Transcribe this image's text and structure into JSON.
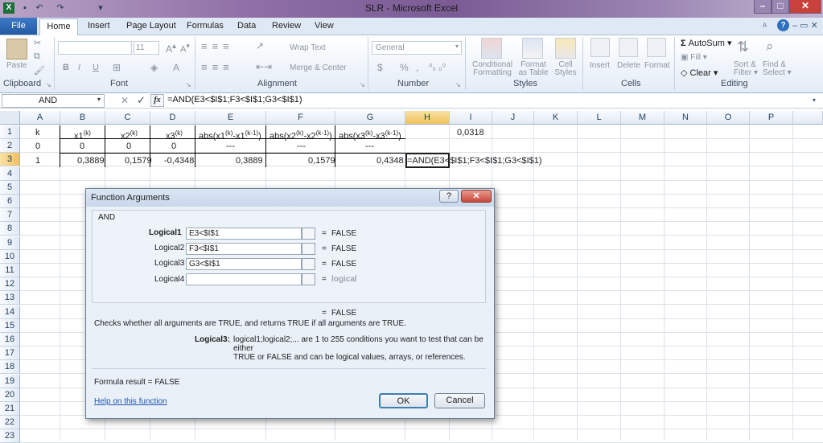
{
  "window": {
    "title": "SLR - Microsoft Excel"
  },
  "tabs": [
    "File",
    "Home",
    "Insert",
    "Page Layout",
    "Formulas",
    "Data",
    "Review",
    "View"
  ],
  "ribbon": {
    "paste": "Paste",
    "font_size": "11",
    "wrap_text": "Wrap Text",
    "merge_center": "Merge & Center",
    "number_format": "General",
    "percent": "%",
    "comma": ",",
    "conditional": [
      "Conditional",
      "Formatting"
    ],
    "format_table": [
      "Format",
      "as Table"
    ],
    "cell_styles": [
      "Cell",
      "Styles"
    ],
    "insert": "Insert",
    "delete": "Delete",
    "format": "Format",
    "autosum": "AutoSum",
    "fill": "Fill",
    "clear": "Clear",
    "sort": [
      "Sort &",
      "Filter"
    ],
    "find": [
      "Find &",
      "Select"
    ],
    "groups": [
      "Clipboard",
      "Font",
      "Alignment",
      "Number",
      "Styles",
      "Cells",
      "Editing"
    ]
  },
  "formula_bar": {
    "name_box": "AND",
    "fx": "fx",
    "formula": "=AND(E3<$I$1;F3<$I$1;G3<$I$1)"
  },
  "sheet": {
    "columns": [
      "A",
      "B",
      "C",
      "D",
      "E",
      "F",
      "G",
      "H",
      "I",
      "J",
      "K",
      "L",
      "M",
      "N",
      "O",
      "P"
    ],
    "rows": [
      "1",
      "2",
      "3",
      "4",
      "5",
      "6",
      "7",
      "8",
      "9",
      "10",
      "11",
      "12",
      "13",
      "14",
      "15",
      "16",
      "17",
      "18",
      "19",
      "20",
      "21",
      "22",
      "23"
    ],
    "row1": {
      "A": "k",
      "B": "x1",
      "C": "x2",
      "D": "x3",
      "E": "abs(x1",
      "E2": "-x1",
      "E3": ")",
      "F": "abs(x2",
      "F2": "-x2",
      "F3": ")",
      "G": "abs(x3",
      "G2": "-x3",
      "G3": ")",
      "I": "0,0318",
      "sup_k": "(k)",
      "sup_k1": "(k-1)"
    },
    "row2": {
      "A": "0",
      "B": "0",
      "C": "0",
      "D": "0",
      "E": "---",
      "F": "---",
      "G": "---"
    },
    "row3": {
      "A": "1",
      "B": "0,3889",
      "C": "0,1579",
      "D": "-0,4348",
      "E": "0,3889",
      "F": "0,1579",
      "G": "0,4348",
      "H": "=AND(E3<$I$1;F3<$I$1;G3<$I$1)"
    }
  },
  "dialog": {
    "title": "Function Arguments",
    "function": "AND",
    "args": [
      {
        "label": "Logical1",
        "value": "E3<$I$1",
        "result": "FALSE"
      },
      {
        "label": "Logical2",
        "value": "F3<$I$1",
        "result": "FALSE"
      },
      {
        "label": "Logical3",
        "value": "G3<$I$1",
        "result": "FALSE"
      },
      {
        "label": "Logical4",
        "value": "",
        "result": "logical"
      }
    ],
    "eq": "=",
    "total": "FALSE",
    "description": "Checks whether all arguments are TRUE, and returns TRUE if all arguments are TRUE.",
    "arg_help_label": "Logical3:",
    "arg_help_text1": "logical1;logical2;... are 1 to 255 conditions you want to test that can be either",
    "arg_help_text2": "TRUE or FALSE and can be logical values, arrays, or references.",
    "formula_result_label": "Formula result =",
    "formula_result": "FALSE",
    "help_link": "Help on this function",
    "ok": "OK",
    "cancel": "Cancel",
    "help_btn": "?",
    "close_btn": "✕"
  }
}
